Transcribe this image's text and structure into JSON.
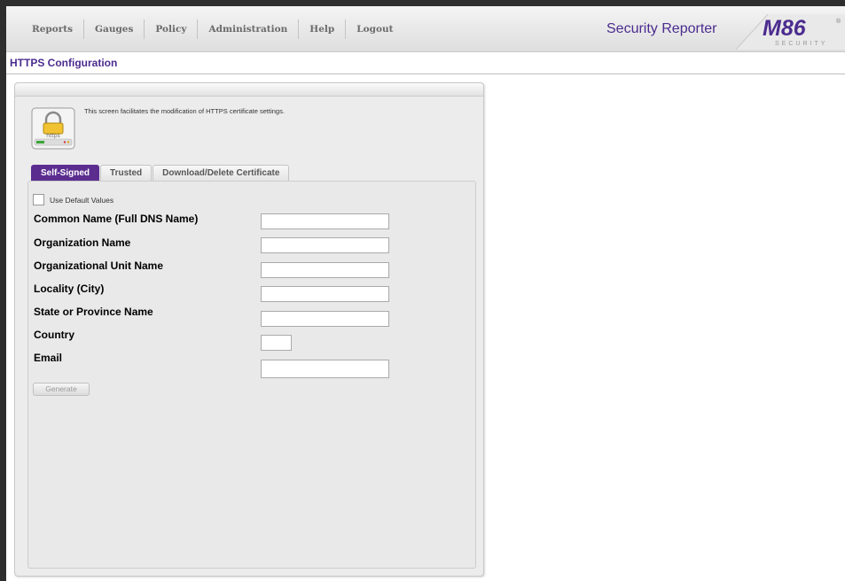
{
  "nav": {
    "items": [
      {
        "label": "Reports"
      },
      {
        "label": "Gauges"
      },
      {
        "label": "Policy"
      },
      {
        "label": "Administration"
      },
      {
        "label": "Help"
      },
      {
        "label": "Logout"
      }
    ],
    "product_title": "Security Reporter",
    "logo": {
      "mark": "M86",
      "sub": "SECURITY"
    }
  },
  "page": {
    "title": "HTTPS Configuration"
  },
  "panel": {
    "icon_label": "https",
    "description": "This screen facilitates the modification of HTTPS certificate settings.",
    "tabs": [
      {
        "label": "Self-Signed",
        "active": true
      },
      {
        "label": "Trusted",
        "active": false
      },
      {
        "label": "Download/Delete Certificate",
        "active": false
      }
    ]
  },
  "form": {
    "use_default_label": "Use Default Values",
    "use_default_checked": false,
    "fields": [
      {
        "label": "Common Name (Full DNS Name)",
        "value": ""
      },
      {
        "label": "Organization Name",
        "value": ""
      },
      {
        "label": "Organizational Unit Name",
        "value": ""
      },
      {
        "label": "Locality (City)",
        "value": ""
      },
      {
        "label": "State or Province Name",
        "value": ""
      },
      {
        "label": "Country",
        "value": ""
      },
      {
        "label": "Email",
        "value": ""
      }
    ],
    "generate_label": "Generate"
  },
  "colors": {
    "accent": "#5b2d8f",
    "title": "#4b2c8f"
  }
}
